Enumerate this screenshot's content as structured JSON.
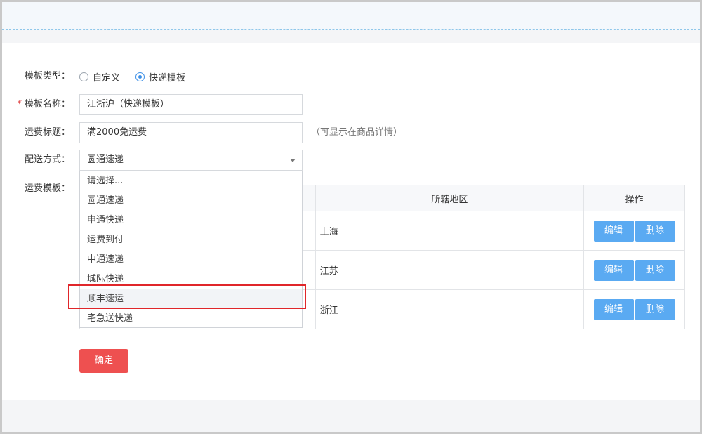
{
  "form": {
    "template_type_label": "模板类型：",
    "template_type_options": [
      "自定义",
      "快递模板"
    ],
    "template_type_selected": 1,
    "template_name_label": "模板名称：",
    "required_mark": "*",
    "template_name_value": "江浙沪（快递模板）",
    "freight_title_label": "运费标题：",
    "freight_title_value": "满2000免运费",
    "freight_title_hint": "（可显示在商品详情）",
    "delivery_method_label": "配送方式：",
    "delivery_method_value": "圆通速递",
    "freight_template_label": "运费模板："
  },
  "dropdown": {
    "options": [
      "请选择...",
      "圆通速递",
      "申通快递",
      "运费到付",
      "中通速递",
      "城际快递",
      "顺丰速运",
      "宅急送快递"
    ],
    "highlighted_index": 6
  },
  "table": {
    "headers": [
      "所辖地区",
      "操作"
    ],
    "rows": [
      {
        "region": "上海"
      },
      {
        "region": "江苏"
      },
      {
        "region": "浙江"
      }
    ],
    "edit_label": "编辑",
    "delete_label": "删除"
  },
  "confirm_label": "确定",
  "colors": {
    "primary_blue": "#5aaaf2",
    "confirm_red": "#ee5050",
    "highlight_box": "#e0262a",
    "radio_active": "#3a8ee6"
  }
}
